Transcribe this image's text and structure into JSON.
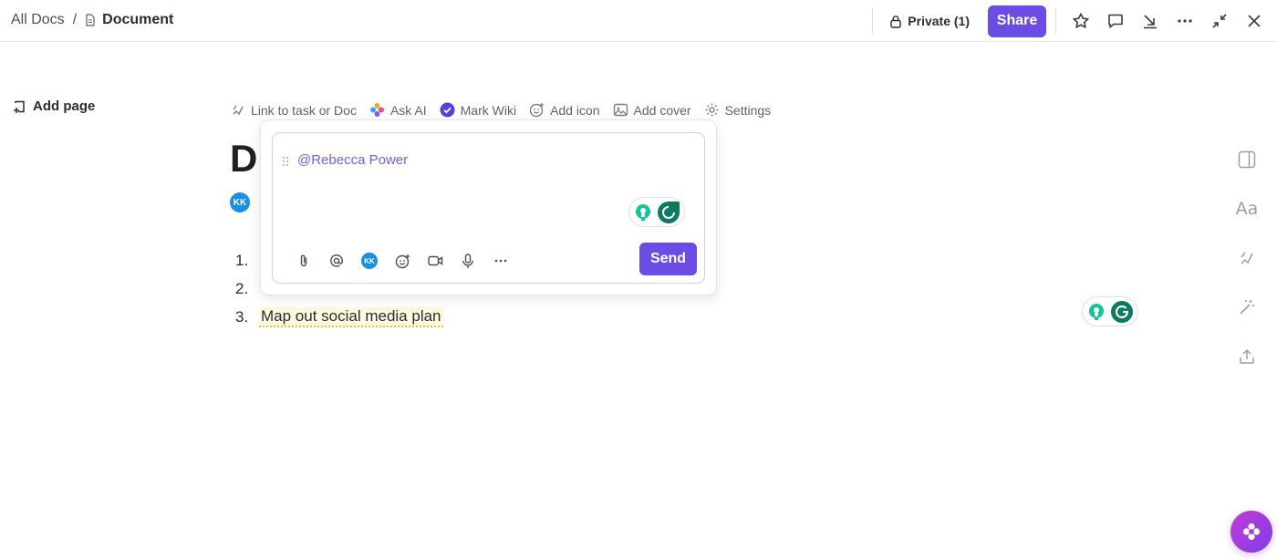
{
  "breadcrumb": {
    "root": "All Docs",
    "separator": "/",
    "current": "Document"
  },
  "header": {
    "privacy_label": "Private (1)",
    "share_label": "Share",
    "tools": [
      "star-icon",
      "comment-icon",
      "export-arrow-icon",
      "more-icon",
      "collapse-icon",
      "close-icon"
    ]
  },
  "sidebar": {
    "add_page_label": "Add page"
  },
  "doc_toolbar": {
    "items": [
      {
        "label": "Link to task or Doc",
        "icon": "link-task-icon"
      },
      {
        "label": "Ask AI",
        "icon": "ai-sparkle-icon"
      },
      {
        "label": "Mark Wiki",
        "icon": "verified-badge-icon"
      },
      {
        "label": "Add icon",
        "icon": "emoji-add-icon"
      },
      {
        "label": "Add cover",
        "icon": "image-icon"
      },
      {
        "label": "Settings",
        "icon": "gear-icon"
      }
    ]
  },
  "document": {
    "title_visible": "D",
    "author_initials": "KK",
    "list": [
      {
        "num": "1.",
        "text": ""
      },
      {
        "num": "2.",
        "text": ""
      },
      {
        "num": "3.",
        "text": "Map out social media plan"
      }
    ]
  },
  "comment_popup": {
    "mention_text": "@Rebecca Power",
    "author_initials": "KK",
    "send_label": "Send",
    "tools": [
      "attach-icon",
      "at-mention-icon",
      "avatar-kk",
      "emoji-add-icon",
      "video-icon",
      "microphone-icon",
      "more-icon"
    ]
  },
  "right_rail": {
    "items": [
      "panel-toggle-icon",
      "font-size-icon",
      "link-arrows-icon",
      "magic-wand-icon",
      "upload-icon"
    ],
    "font_label": "Aa"
  },
  "colors": {
    "accent": "#6b4de6",
    "avatar_blue": "#1a8fe6",
    "grammarly_green": "#15c39a",
    "grammarly_dark": "#0b7a5f",
    "highlight": "#fff8dc"
  }
}
